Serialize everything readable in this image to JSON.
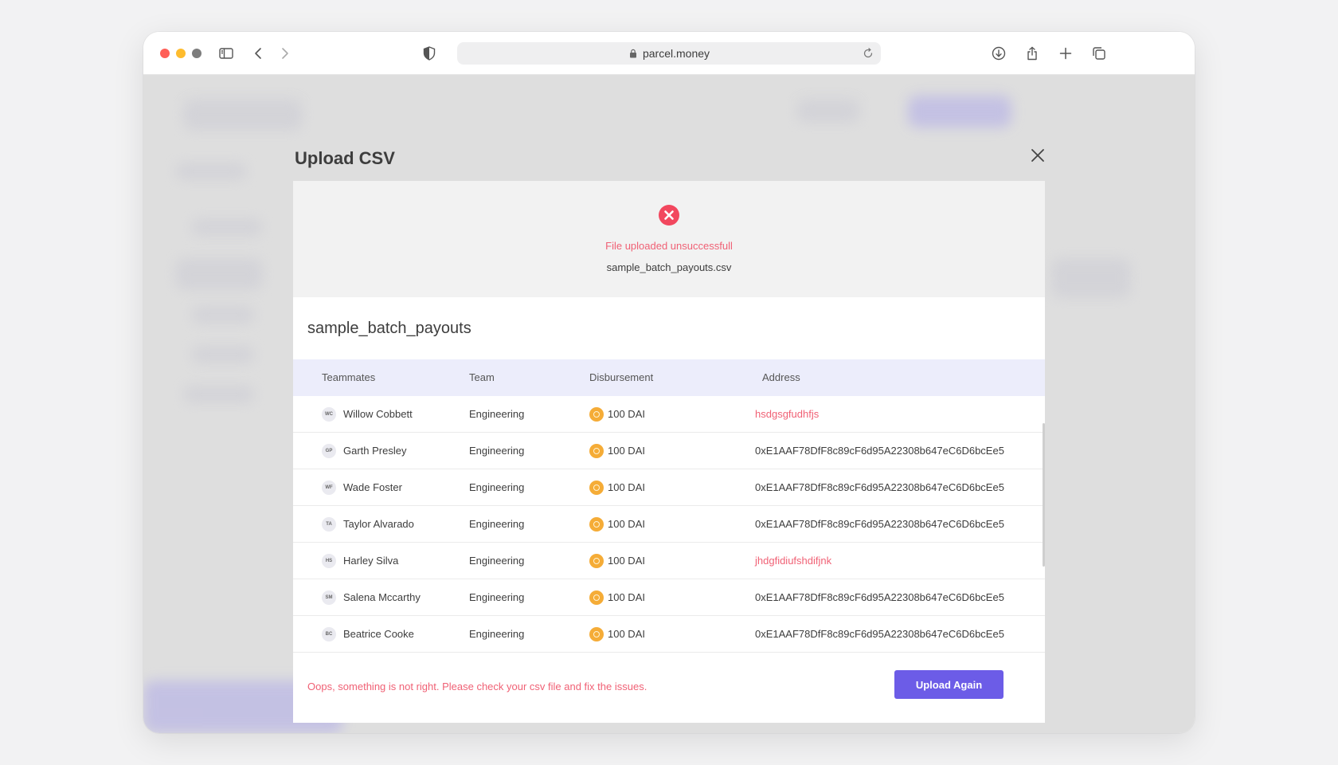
{
  "browser": {
    "url": "parcel.money"
  },
  "modal": {
    "title": "Upload CSV",
    "status": {
      "message": "File uploaded unsuccessfull",
      "file_name": "sample_batch_payouts.csv"
    },
    "table": {
      "title": "sample_batch_payouts",
      "headers": [
        "Teammates",
        "Team",
        "Disbursement",
        "Address"
      ],
      "rows": [
        {
          "initials": "WC",
          "name": "Willow Cobbett",
          "team": "Engineering",
          "amount": "100 DAI",
          "address": "hsdgsgfudhfjs",
          "valid": false
        },
        {
          "initials": "GP",
          "name": "Garth Presley",
          "team": "Engineering",
          "amount": "100 DAI",
          "address": "0xE1AAF78DfF8c89cF6d95A22308b647eC6D6bcEe5",
          "valid": true
        },
        {
          "initials": "WF",
          "name": "Wade Foster",
          "team": "Engineering",
          "amount": "100 DAI",
          "address": "0xE1AAF78DfF8c89cF6d95A22308b647eC6D6bcEe5",
          "valid": true
        },
        {
          "initials": "TA",
          "name": "Taylor Alvarado",
          "team": "Engineering",
          "amount": "100 DAI",
          "address": "0xE1AAF78DfF8c89cF6d95A22308b647eC6D6bcEe5",
          "valid": true
        },
        {
          "initials": "HS",
          "name": "Harley Silva",
          "team": "Engineering",
          "amount": "100 DAI",
          "address": "jhdgfidiufshdifjnk",
          "valid": false
        },
        {
          "initials": "SM",
          "name": "Salena Mccarthy",
          "team": "Engineering",
          "amount": "100 DAI",
          "address": "0xE1AAF78DfF8c89cF6d95A22308b647eC6D6bcEe5",
          "valid": true
        },
        {
          "initials": "BC",
          "name": "Beatrice Cooke",
          "team": "Engineering",
          "amount": "100 DAI",
          "address": "0xE1AAF78DfF8c89cF6d95A22308b647eC6D6bcEe5",
          "valid": true
        }
      ]
    },
    "footer": {
      "error_message": "Oops, something is not right. Please check your csv file and fix the issues.",
      "button_label": "Upload Again"
    }
  },
  "colors": {
    "error": "#f06175",
    "primary": "#6c5ce7",
    "token": "#f5ac37",
    "header_bg": "#ecedfb"
  },
  "icons": [
    "sidebar-icon",
    "back-icon",
    "forward-icon",
    "shield-icon",
    "lock-icon",
    "reload-icon",
    "download-icon",
    "share-icon",
    "new-tab-icon",
    "tabs-icon",
    "close-icon",
    "error-icon",
    "dai-coin-icon"
  ]
}
